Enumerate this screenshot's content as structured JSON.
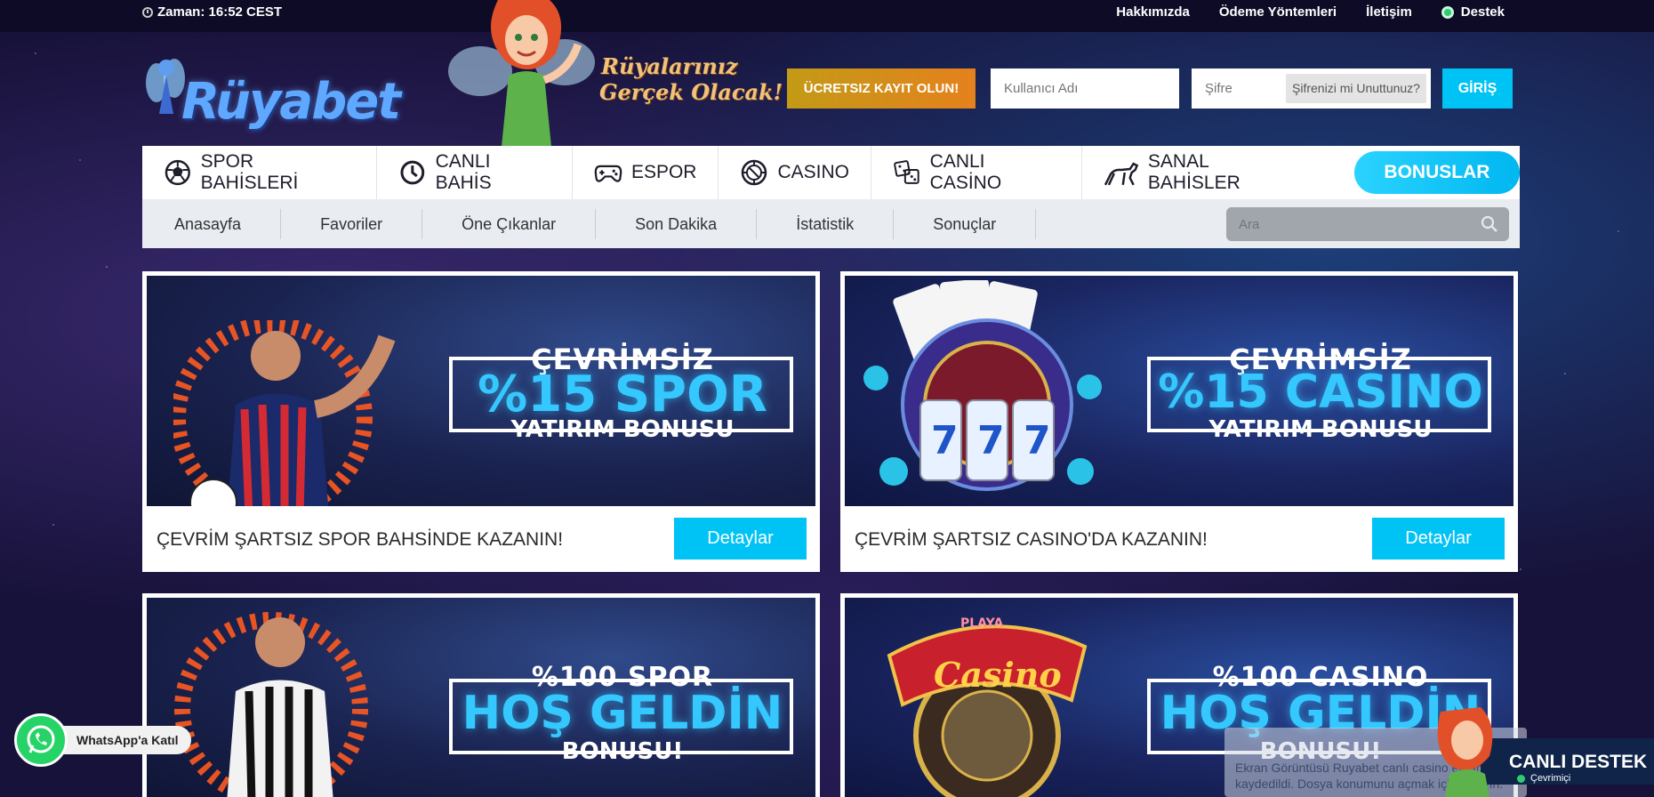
{
  "topbar": {
    "time": "Zaman: 16:52 CEST",
    "links": [
      "Hakkımızda",
      "Ödeme Yöntemleri",
      "İletişim"
    ],
    "support": "Destek"
  },
  "header": {
    "logo_text": "Rüyabet",
    "slogan_line1": "Rüyalarınız",
    "slogan_line2": "Gerçek Olacak!",
    "register_label": "ÜCRETSIZ KAYIT OLUN!",
    "username_placeholder": "Kullanıcı Adı",
    "password_placeholder": "Şifre",
    "forgot_label": "Şifrenizi mi Unuttunuz?",
    "login_label": "GİRİŞ"
  },
  "nav": {
    "items": [
      {
        "label": "SPOR BAHİSLERİ",
        "icon": "soccer-ball-icon"
      },
      {
        "label": "CANLI BAHİS",
        "icon": "clock-icon"
      },
      {
        "label": "ESPOR",
        "icon": "gamepad-icon"
      },
      {
        "label": "CASINO",
        "icon": "roulette-icon"
      },
      {
        "label": "CANLI CASİNO",
        "icon": "dice-icon"
      },
      {
        "label": "SANAL BAHİSLER",
        "icon": "greyhound-icon"
      }
    ],
    "bonus_label": "BONUSLAR"
  },
  "subnav": {
    "items": [
      "Anasayfa",
      "Favoriler",
      "Öne Çıkanlar",
      "Son Dakika",
      "İstatistik",
      "Sonuçlar"
    ],
    "search_placeholder": "Ara"
  },
  "promos": [
    {
      "top": "ÇEVRİMSİZ",
      "big": "%15 SPOR",
      "sub": "YATIRIM BONUSU",
      "caption": "ÇEVRİM ŞARTSIZ SPOR BAHSİNDE KAZANIN!",
      "button": "Detaylar"
    },
    {
      "top": "ÇEVRİMSİZ",
      "big": "%15 CASINO",
      "sub": "YATIRIM BONUSU",
      "caption": "ÇEVRİM ŞARTSIZ CASINO'DA KAZANIN!",
      "button": "Detaylar"
    },
    {
      "top": "%100 SPOR",
      "big": "HOŞ GELDİN",
      "sub": "BONUSU!"
    },
    {
      "top": "%100 CASINO",
      "big": "HOŞ GELDİN",
      "sub": "BONUSU!",
      "sign": "Casino",
      "sign_top": "PLAYA"
    }
  ],
  "whatsapp": {
    "label": "WhatsApp'a Katıl"
  },
  "toast": {
    "text": "Ekran Görüntüsü Ruyabet canlı casino ekranına kaydedildi. Dosya konumunu açmak için tıklayın."
  },
  "live_support": {
    "title": "CANLI DESTEK",
    "status": "Çevrimiçi"
  },
  "colors": {
    "accent": "#00c3f5",
    "register": "#e5811d",
    "nav_bg": "#ffffff",
    "subnav_bg": "#e9ecf1",
    "page_bg": "#17123a"
  }
}
